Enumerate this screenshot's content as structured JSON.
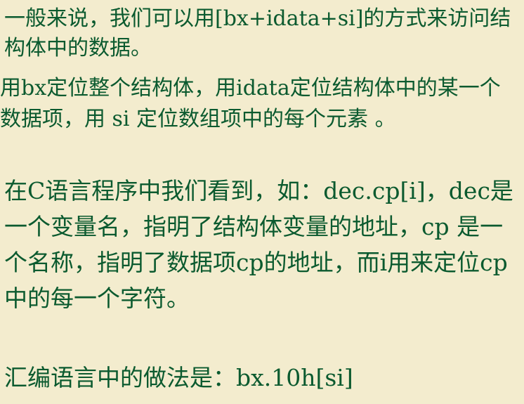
{
  "paragraphs": [
    "一般来说，我们可以用[bx+idata+si]的方式来访问结构体中的数据。",
    "用bx定位整个结构体，用idata定位结构体中的某一个数据项，用 si 定位数组项中的每个元素 。",
    "在C语言程序中我们看到，如：dec.cp[i]，dec是一个变量名，指明了结构体变量的地址，cp 是一个名称，指明了数据项cp的地址，而i用来定位cp中的每一个字符。",
    "汇编语言中的做法是：bx.10h[si]"
  ],
  "colors": {
    "background": "#f3ecce",
    "text": "#0b5a2f"
  }
}
